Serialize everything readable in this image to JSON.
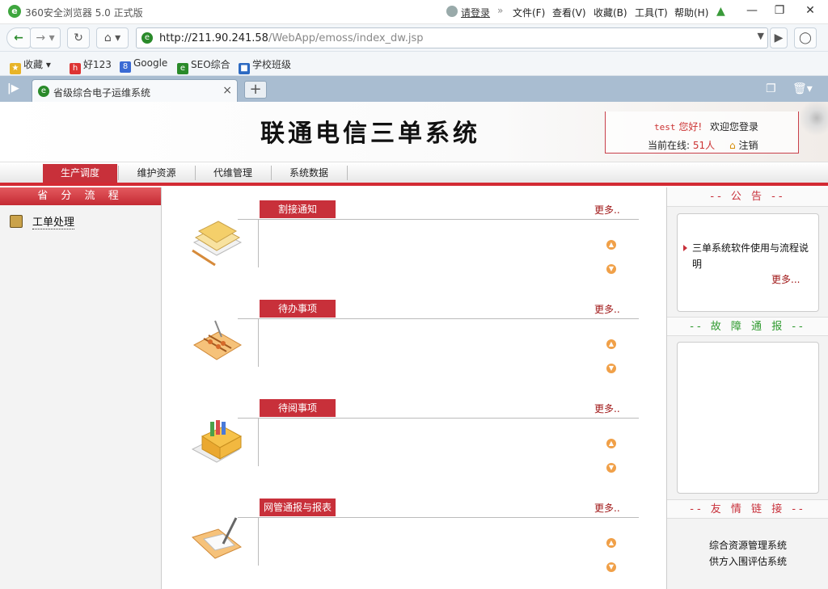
{
  "browser": {
    "app_title": "360安全浏览器 5.0 正式版",
    "login": "请登录",
    "menus": [
      "文件(F)",
      "查看(V)",
      "收藏(B)",
      "工具(T)",
      "帮助(H)"
    ],
    "url_host": "http://211.90.241.58",
    "url_path": "/WebApp/emoss/index_dw.jsp",
    "bookmarks": [
      "收藏",
      "好123",
      "Google",
      "SEO综合",
      "学校班级"
    ],
    "tab_title": "省级综合电子运维系统"
  },
  "header": {
    "system_title": "联通电信三单系统",
    "user": "test",
    "hello": "您好!",
    "welcome": "欢迎您登录",
    "online_label": "当前在线:",
    "online_count": "51人",
    "logout": "注销"
  },
  "nav": {
    "items": [
      "生产调度",
      "维护资源",
      "代维管理",
      "系统数据"
    ]
  },
  "left_panel": {
    "title": "省 分 流 程",
    "item": "工单处理"
  },
  "sections": [
    {
      "title": "割接通知",
      "more": "更多.."
    },
    {
      "title": "待办事项",
      "more": "更多.."
    },
    {
      "title": "待阅事项",
      "more": "更多.."
    },
    {
      "title": "网管通报与报表",
      "more": "更多.."
    }
  ],
  "right_panel": {
    "notice_title": "-- 公 告 --",
    "notice_item": "三单系统软件使用与流程说明",
    "notice_more": "更多...",
    "fault_title": "-- 故 障 通 报 --",
    "links_title": "-- 友 情 链 接 --",
    "links": [
      "综合资源管理系统",
      "供方入围评估系统"
    ]
  }
}
